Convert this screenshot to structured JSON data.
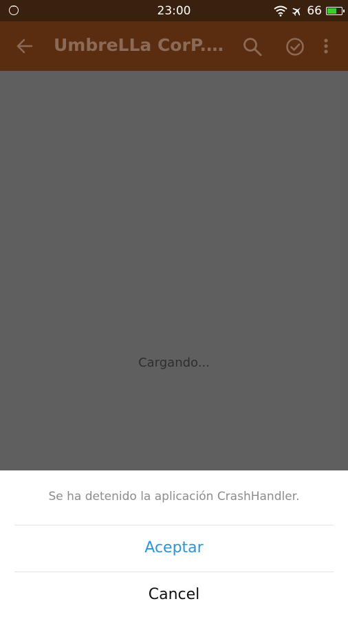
{
  "status_bar": {
    "time": "23:00",
    "battery_level": "66",
    "icons": [
      "message-icon",
      "wifi-icon",
      "airplane-icon",
      "battery-icon"
    ],
    "battery_fill_fraction": 0.66,
    "battery_color": "#3ccc2b"
  },
  "app_bar": {
    "title": "UmbreLLa CorP. L...",
    "background": "#5a2c10",
    "icons": [
      "back-arrow-icon",
      "search-icon",
      "check-circle-icon",
      "more-vert-icon"
    ]
  },
  "content": {
    "loading_text": "Cargando..."
  },
  "dialog": {
    "message": "Se ha detenido la aplicación CrashHandler.",
    "accept_label": "Aceptar",
    "cancel_label": "Cancel",
    "accent": "#2d94d6"
  }
}
